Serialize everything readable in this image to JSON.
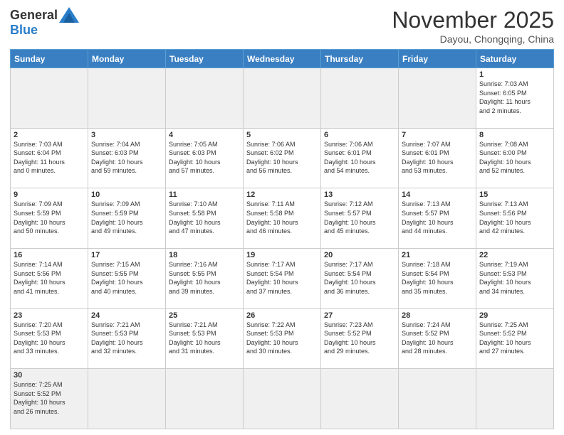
{
  "header": {
    "logo_general": "General",
    "logo_blue": "Blue",
    "month_title": "November 2025",
    "subtitle": "Dayou, Chongqing, China"
  },
  "days_of_week": [
    "Sunday",
    "Monday",
    "Tuesday",
    "Wednesday",
    "Thursday",
    "Friday",
    "Saturday"
  ],
  "weeks": [
    [
      {
        "day": "",
        "info": "",
        "empty": true
      },
      {
        "day": "",
        "info": "",
        "empty": true
      },
      {
        "day": "",
        "info": "",
        "empty": true
      },
      {
        "day": "",
        "info": "",
        "empty": true
      },
      {
        "day": "",
        "info": "",
        "empty": true
      },
      {
        "day": "",
        "info": "",
        "empty": true
      },
      {
        "day": "1",
        "info": "Sunrise: 7:03 AM\nSunset: 6:05 PM\nDaylight: 11 hours\nand 2 minutes."
      }
    ],
    [
      {
        "day": "2",
        "info": "Sunrise: 7:03 AM\nSunset: 6:04 PM\nDaylight: 11 hours\nand 0 minutes."
      },
      {
        "day": "3",
        "info": "Sunrise: 7:04 AM\nSunset: 6:03 PM\nDaylight: 10 hours\nand 59 minutes."
      },
      {
        "day": "4",
        "info": "Sunrise: 7:05 AM\nSunset: 6:03 PM\nDaylight: 10 hours\nand 57 minutes."
      },
      {
        "day": "5",
        "info": "Sunrise: 7:06 AM\nSunset: 6:02 PM\nDaylight: 10 hours\nand 56 minutes."
      },
      {
        "day": "6",
        "info": "Sunrise: 7:06 AM\nSunset: 6:01 PM\nDaylight: 10 hours\nand 54 minutes."
      },
      {
        "day": "7",
        "info": "Sunrise: 7:07 AM\nSunset: 6:01 PM\nDaylight: 10 hours\nand 53 minutes."
      },
      {
        "day": "8",
        "info": "Sunrise: 7:08 AM\nSunset: 6:00 PM\nDaylight: 10 hours\nand 52 minutes."
      }
    ],
    [
      {
        "day": "9",
        "info": "Sunrise: 7:09 AM\nSunset: 5:59 PM\nDaylight: 10 hours\nand 50 minutes."
      },
      {
        "day": "10",
        "info": "Sunrise: 7:09 AM\nSunset: 5:59 PM\nDaylight: 10 hours\nand 49 minutes."
      },
      {
        "day": "11",
        "info": "Sunrise: 7:10 AM\nSunset: 5:58 PM\nDaylight: 10 hours\nand 47 minutes."
      },
      {
        "day": "12",
        "info": "Sunrise: 7:11 AM\nSunset: 5:58 PM\nDaylight: 10 hours\nand 46 minutes."
      },
      {
        "day": "13",
        "info": "Sunrise: 7:12 AM\nSunset: 5:57 PM\nDaylight: 10 hours\nand 45 minutes."
      },
      {
        "day": "14",
        "info": "Sunrise: 7:13 AM\nSunset: 5:57 PM\nDaylight: 10 hours\nand 44 minutes."
      },
      {
        "day": "15",
        "info": "Sunrise: 7:13 AM\nSunset: 5:56 PM\nDaylight: 10 hours\nand 42 minutes."
      }
    ],
    [
      {
        "day": "16",
        "info": "Sunrise: 7:14 AM\nSunset: 5:56 PM\nDaylight: 10 hours\nand 41 minutes."
      },
      {
        "day": "17",
        "info": "Sunrise: 7:15 AM\nSunset: 5:55 PM\nDaylight: 10 hours\nand 40 minutes."
      },
      {
        "day": "18",
        "info": "Sunrise: 7:16 AM\nSunset: 5:55 PM\nDaylight: 10 hours\nand 39 minutes."
      },
      {
        "day": "19",
        "info": "Sunrise: 7:17 AM\nSunset: 5:54 PM\nDaylight: 10 hours\nand 37 minutes."
      },
      {
        "day": "20",
        "info": "Sunrise: 7:17 AM\nSunset: 5:54 PM\nDaylight: 10 hours\nand 36 minutes."
      },
      {
        "day": "21",
        "info": "Sunrise: 7:18 AM\nSunset: 5:54 PM\nDaylight: 10 hours\nand 35 minutes."
      },
      {
        "day": "22",
        "info": "Sunrise: 7:19 AM\nSunset: 5:53 PM\nDaylight: 10 hours\nand 34 minutes."
      }
    ],
    [
      {
        "day": "23",
        "info": "Sunrise: 7:20 AM\nSunset: 5:53 PM\nDaylight: 10 hours\nand 33 minutes."
      },
      {
        "day": "24",
        "info": "Sunrise: 7:21 AM\nSunset: 5:53 PM\nDaylight: 10 hours\nand 32 minutes."
      },
      {
        "day": "25",
        "info": "Sunrise: 7:21 AM\nSunset: 5:53 PM\nDaylight: 10 hours\nand 31 minutes."
      },
      {
        "day": "26",
        "info": "Sunrise: 7:22 AM\nSunset: 5:53 PM\nDaylight: 10 hours\nand 30 minutes."
      },
      {
        "day": "27",
        "info": "Sunrise: 7:23 AM\nSunset: 5:52 PM\nDaylight: 10 hours\nand 29 minutes."
      },
      {
        "day": "28",
        "info": "Sunrise: 7:24 AM\nSunset: 5:52 PM\nDaylight: 10 hours\nand 28 minutes."
      },
      {
        "day": "29",
        "info": "Sunrise: 7:25 AM\nSunset: 5:52 PM\nDaylight: 10 hours\nand 27 minutes."
      }
    ],
    [
      {
        "day": "30",
        "info": "Sunrise: 7:25 AM\nSunset: 5:52 PM\nDaylight: 10 hours\nand 26 minutes.",
        "last": true
      },
      {
        "day": "",
        "info": "",
        "empty": true,
        "last": true
      },
      {
        "day": "",
        "info": "",
        "empty": true,
        "last": true
      },
      {
        "day": "",
        "info": "",
        "empty": true,
        "last": true
      },
      {
        "day": "",
        "info": "",
        "empty": true,
        "last": true
      },
      {
        "day": "",
        "info": "",
        "empty": true,
        "last": true
      },
      {
        "day": "",
        "info": "",
        "empty": true,
        "last": true
      }
    ]
  ]
}
